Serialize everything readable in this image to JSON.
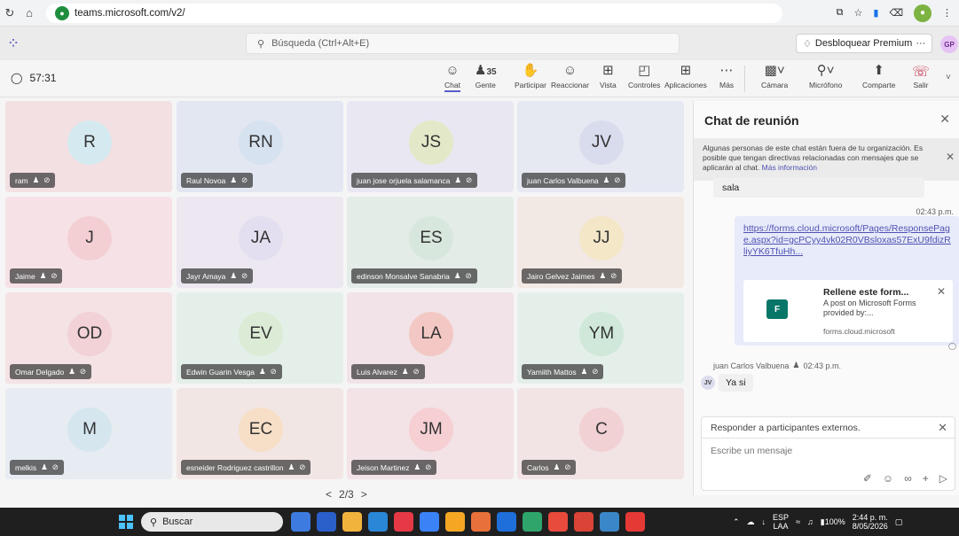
{
  "browser": {
    "url": "teams.microsoft.com/v2/"
  },
  "teams": {
    "search_placeholder": "Búsqueda (Ctrl+Alt+E)",
    "premium_label": "Desbloquear Premium",
    "premium_more": "···",
    "user_initials": "GP"
  },
  "meeting": {
    "timer": "57:31",
    "participant_count": "35",
    "tools": {
      "chat": "Chat",
      "people": "Gente",
      "raise": "Participar",
      "react": "Reaccionar",
      "view": "Vista",
      "controls": "Controles",
      "apps": "Aplicaciones",
      "more": "Más",
      "camera": "Cámara",
      "mic": "Micrófono",
      "share": "Comparte",
      "leave": "Salir"
    }
  },
  "participants": [
    {
      "initials": "R",
      "name": "ram"
    },
    {
      "initials": "RN",
      "name": "Raul Novoa"
    },
    {
      "initials": "JS",
      "name": "juan jose orjuela salamanca"
    },
    {
      "initials": "JV",
      "name": "juan Carlos Valbuena"
    },
    {
      "initials": "J",
      "name": "Jaime"
    },
    {
      "initials": "JA",
      "name": "Jayr Amaya"
    },
    {
      "initials": "ES",
      "name": "edinson Monsalve Sanabria"
    },
    {
      "initials": "JJ",
      "name": "Jairo Gelvez Jaimes"
    },
    {
      "initials": "OD",
      "name": "Omar Delgado"
    },
    {
      "initials": "EV",
      "name": "Edwin Guarin Vesga"
    },
    {
      "initials": "LA",
      "name": "Luis Alvarez"
    },
    {
      "initials": "YM",
      "name": "Yamiith Mattos"
    },
    {
      "initials": "M",
      "name": "melkis"
    },
    {
      "initials": "EC",
      "name": "esneider Rodriguez castrillon"
    },
    {
      "initials": "JM",
      "name": "Jeison Martinez"
    },
    {
      "initials": "C",
      "name": "Carlos"
    }
  ],
  "pager": {
    "prev": "<",
    "label": "2/3",
    "next": ">"
  },
  "chat": {
    "title": "Chat de reunión",
    "notice": "Algunas personas de este chat están fuera de tu organización. Es posible que tengan directivas relacionadas con mensajes que se aplicarán al chat.",
    "notice_link": "Más información",
    "prev_message": "sala",
    "msg_time": "02:43 p.m.",
    "link_text": "https://forms.cloud.microsoft/Pages/ResponsePage.aspx?id=gcPCyy4vk02R0VBsloxas57ExU9fdizRliyYK6TfuHh...",
    "card": {
      "title": "Rellene este form...",
      "desc": "A post on Microsoft Forms provided by:...",
      "domain": "forms.cloud.microsoft"
    },
    "reply_sender": "juan Carlos Valbuena",
    "reply_time": "02:43 p.m.",
    "reply_initials": "JV",
    "reply_text": "Ya si",
    "compose_header": "Responder a participantes externos.",
    "compose_placeholder": "Escribe un mensaje"
  },
  "taskbar": {
    "search_label": "Buscar",
    "lang_top": "ESP",
    "lang_bottom": "LAA",
    "battery": "100%",
    "time": "2:44 p. m.",
    "date": "8/05/2026"
  },
  "tile_colors": [
    "#f3e0e3",
    "#e3e7f2",
    "#e9e7f1",
    "#e6e9f2",
    "#f6e2e6",
    "#ece7f1",
    "#e4ece8",
    "#f2e8e4",
    "#f4e2e4",
    "#e4efe9",
    "#f1e3e7",
    "#e4efea",
    "#e6ecf1",
    "#f2e6e4",
    "#f3e2e6",
    "#f2e3e4"
  ],
  "circle_colors": [
    "#d5eaf0",
    "#d6e2f0",
    "#e3e8c9",
    "#d9dced",
    "#f3cfd4",
    "#e4dff0",
    "#d8e7de",
    "#f3e7c8",
    "#f2d2d6",
    "#dcebd5",
    "#f3c8c4",
    "#cfe8da",
    "#d6e6ef",
    "#f6dfc6",
    "#f6cfd2",
    "#f1d1d4"
  ],
  "taskbar_app_colors": [
    "#3d7be0",
    "#2b5fc9",
    "#f2b33d",
    "#2a86d6",
    "#e63946",
    "#3b82f6",
    "#f5a623",
    "#e8703a",
    "#1e6fd9",
    "#2fa56b",
    "#e84a3c",
    "#d94436",
    "#3a86c8",
    "#e53935"
  ]
}
